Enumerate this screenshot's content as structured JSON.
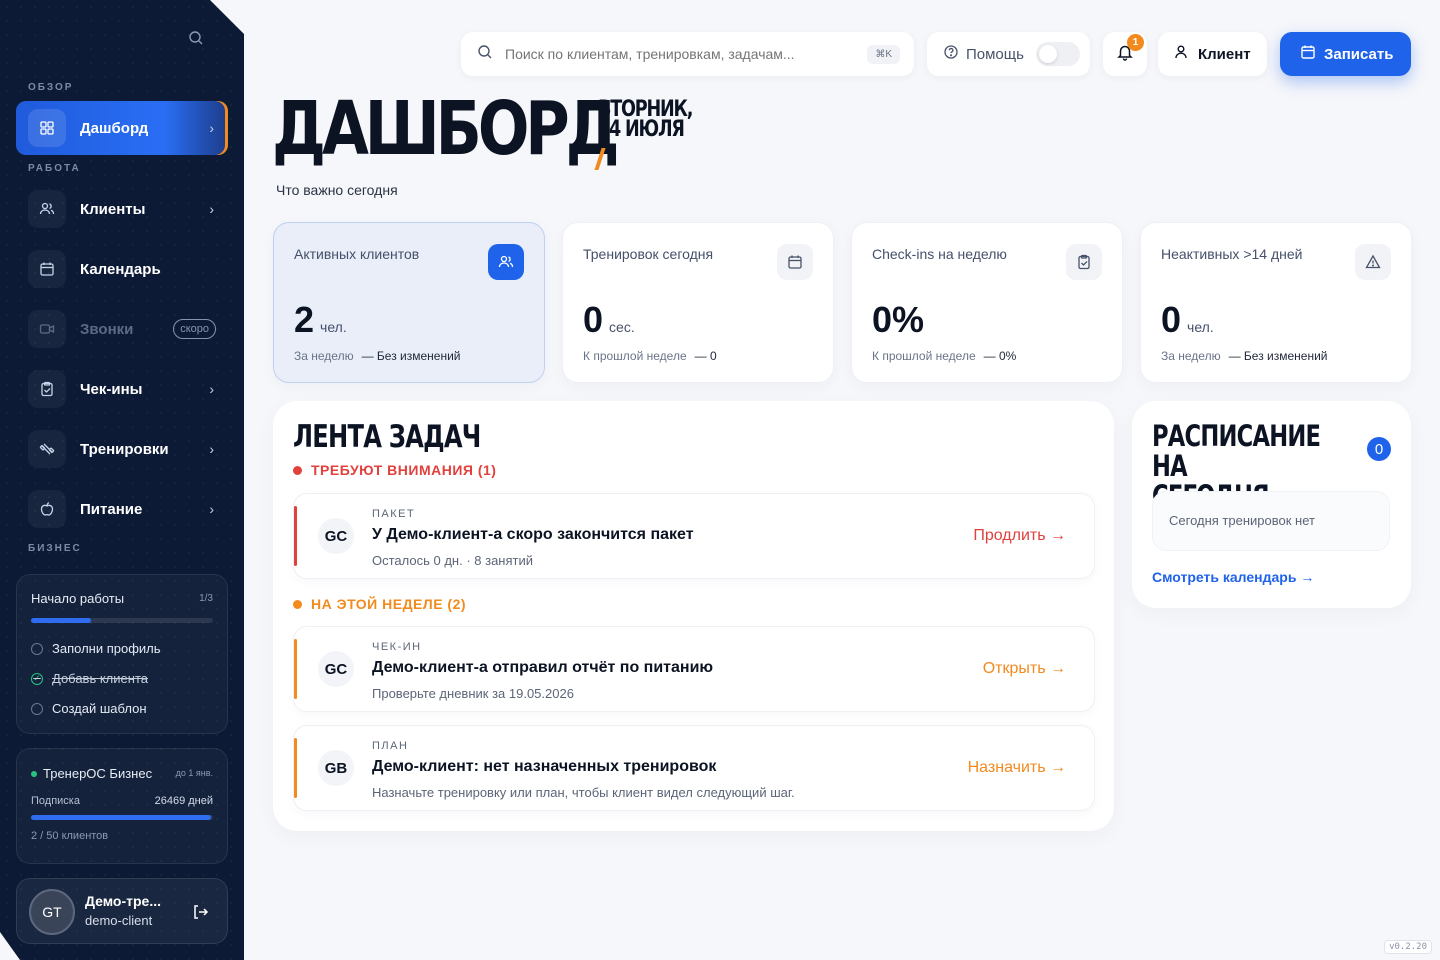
{
  "sidebar": {
    "sections": {
      "overview": "ОБЗОР",
      "work": "РАБОТА",
      "business": "БИЗНЕС"
    },
    "items": [
      {
        "label": "Дашборд",
        "icon": "grid-icon",
        "active": true
      },
      {
        "label": "Клиенты",
        "icon": "users-icon"
      },
      {
        "label": "Календарь",
        "icon": "calendar-icon"
      },
      {
        "label": "Звонки",
        "icon": "video-icon",
        "badge": "скоро"
      },
      {
        "label": "Чек-ины",
        "icon": "clipboard-check-icon"
      },
      {
        "label": "Тренировки",
        "icon": "dumbbell-icon"
      },
      {
        "label": "Питание",
        "icon": "apple-icon"
      }
    ],
    "onboarding": {
      "title": "Начало работы",
      "count": "1/3",
      "progress": 0.33,
      "tasks": [
        {
          "label": "Заполни профиль",
          "done": false
        },
        {
          "label": "Добавь клиента",
          "done": true
        },
        {
          "label": "Создай шаблон",
          "done": false
        }
      ]
    },
    "plan": {
      "name": "ТренерОС Бизнес",
      "until": "до 1 янв.",
      "subscription_label": "Подписка",
      "subscription_value": "26469 дней",
      "clients": "2 / 50 клиентов",
      "progress": 0.04
    },
    "user": {
      "initials": "GT",
      "name": "Демо-тре...",
      "login": "demo-client"
    }
  },
  "header": {
    "search_placeholder": "Поиск по клиентам, тренировкам, задачам...",
    "search_shortcut": "⌘K",
    "help_label": "Помощь",
    "notifications_count": "1",
    "client_label": "Клиент",
    "book_label": "Записать"
  },
  "page": {
    "title": "ДАШБОРД",
    "date_line1": "ВТОРНИК,",
    "date_line2": "14 ИЮЛЯ",
    "subtitle": "Что важно сегодня"
  },
  "stats": [
    {
      "title": "Активных клиентов",
      "value": "2",
      "unit": "чел.",
      "footer_label": "За неделю",
      "footer_value": "— Без изменений",
      "icon": "users-icon"
    },
    {
      "title": "Тренировок сегодня",
      "value": "0",
      "unit": "сес.",
      "footer_label": "К прошлой неделе",
      "footer_value": "— 0",
      "icon": "calendar-icon"
    },
    {
      "title": "Check-ins на неделю",
      "value": "0%",
      "unit": "",
      "footer_label": "К прошлой неделе",
      "footer_value": "— 0%",
      "icon": "clipboard-check-icon"
    },
    {
      "title": "Неактивных >14 дней",
      "value": "0",
      "unit": "чел.",
      "footer_label": "За неделю",
      "footer_value": "— Без изменений",
      "icon": "alert-triangle-icon"
    }
  ],
  "feed": {
    "title": "ЛЕНТА ЗАДАЧ",
    "group_attention": "ТРЕБУЮТ ВНИМАНИЯ (1)",
    "group_week": "НА ЭТОЙ НЕДЕЛЕ (2)",
    "colors": {
      "attention": "#e0413d",
      "week": "#f28a1e"
    },
    "tasks": [
      {
        "kind": "ПАКЕТ",
        "initials": "GC",
        "title": "У Демо-клиент-а скоро закончится пакет",
        "sub": "Осталось 0 дн. · 8 занятий",
        "action": "Продлить →"
      },
      {
        "kind": "ЧЕК-ИН",
        "initials": "GC",
        "title": "Демо-клиент-а отправил отчёт по питанию",
        "sub": "Проверьте дневник за 19.05.2026",
        "action": "Открыть →"
      },
      {
        "kind": "ПЛАН",
        "initials": "GB",
        "title": "Демо-клиент: нет назначенных тренировок",
        "sub": "Назначьте тренировку или план, чтобы клиент видел следующий шаг.",
        "action": "Назначить →"
      }
    ]
  },
  "schedule": {
    "title_line1": "РАСПИСАНИЕ НА",
    "title_line2": "СЕГОДНЯ",
    "count": "0",
    "empty": "Сегодня тренировок нет",
    "link": "Смотреть календарь →"
  },
  "version": "v0.2.20"
}
